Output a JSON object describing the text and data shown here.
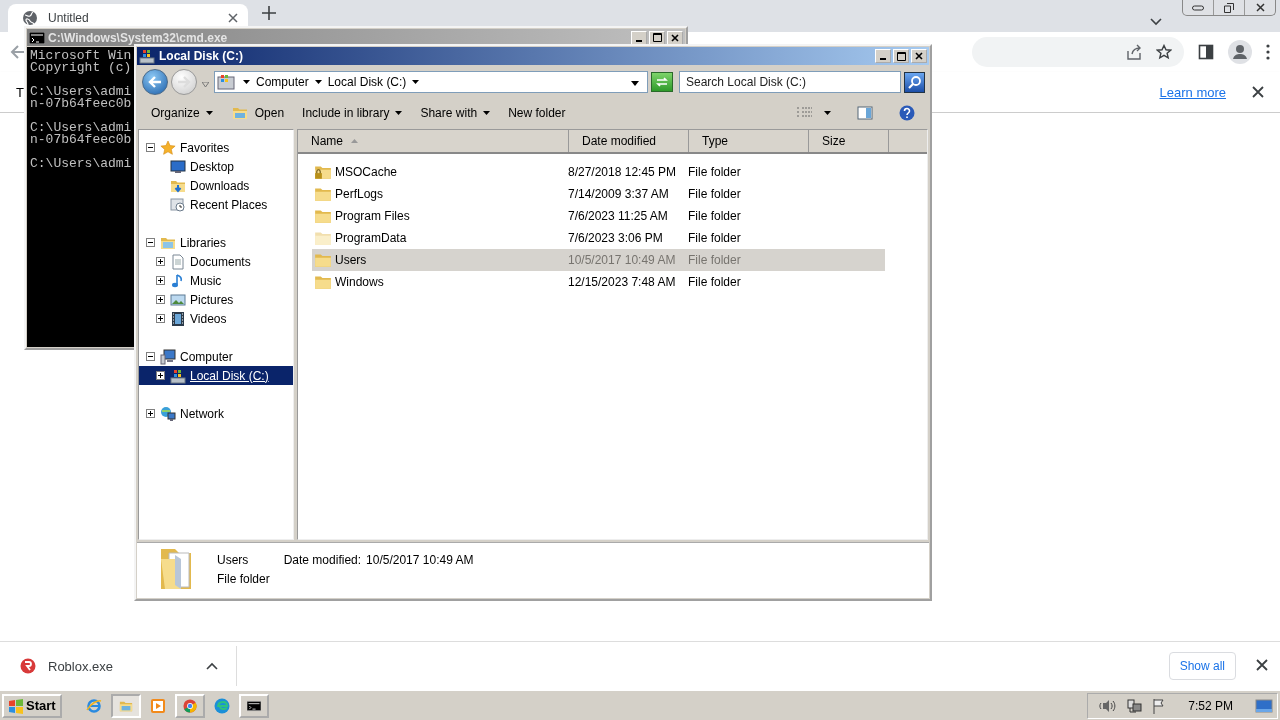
{
  "browser": {
    "tabs": [
      {
        "title": "Untitled",
        "selected": true
      }
    ],
    "infobar": {
      "text": "T",
      "link": "Learn more"
    },
    "download_shelf": {
      "items": [
        {
          "name": "Roblox.exe"
        }
      ],
      "show_all": "Show all"
    }
  },
  "cmd_window": {
    "title": "C:\\Windows\\System32\\cmd.exe",
    "active": false,
    "blocks": [
      [
        "Microsoft Win",
        "Copyright (c)"
      ],
      [
        "C:\\Users\\admi",
        "n-07b64feec0b"
      ],
      [
        "C:\\Users\\admi",
        "n-07b64feec0b"
      ],
      [
        "C:\\Users\\admi"
      ]
    ]
  },
  "explorer": {
    "title": "Local Disk (C:)",
    "active": true,
    "breadcrumb": [
      "Computer",
      "Local Disk (C:)"
    ],
    "search": {
      "placeholder": "Search Local Disk (C:)"
    },
    "toolbar": [
      {
        "label": "Organize",
        "dropdown": true,
        "icon": false
      },
      {
        "label": "Open",
        "dropdown": false,
        "icon": true
      },
      {
        "label": "Include in library",
        "dropdown": true,
        "icon": false
      },
      {
        "label": "Share with",
        "dropdown": true,
        "icon": false
      },
      {
        "label": "New folder",
        "dropdown": false,
        "icon": false
      }
    ],
    "nav": [
      {
        "label": "Favorites",
        "kind": "star",
        "expanded": true,
        "selected": false,
        "children": [
          {
            "label": "Desktop",
            "kind": "desktop",
            "selected": false
          },
          {
            "label": "Downloads",
            "kind": "download",
            "selected": false
          },
          {
            "label": "Recent Places",
            "kind": "recent",
            "selected": false
          }
        ]
      },
      {
        "label": "Libraries",
        "kind": "library",
        "expanded": true,
        "selected": false,
        "children": [
          {
            "label": "Documents",
            "kind": "document",
            "expanded": false,
            "selected": false
          },
          {
            "label": "Music",
            "kind": "music",
            "expanded": false,
            "selected": false
          },
          {
            "label": "Pictures",
            "kind": "pictures",
            "expanded": false,
            "selected": false
          },
          {
            "label": "Videos",
            "kind": "video",
            "expanded": false,
            "selected": false
          }
        ]
      },
      {
        "label": "Computer",
        "kind": "computer",
        "expanded": true,
        "selected": false,
        "children": [
          {
            "label": "Local Disk (C:)",
            "kind": "disk",
            "expanded": false,
            "selected": true
          }
        ]
      },
      {
        "label": "Network",
        "kind": "network",
        "expanded": false,
        "selected": false
      }
    ],
    "columns": [
      {
        "label": "Name",
        "sorted": true
      },
      {
        "label": "Date modified",
        "sorted": false
      },
      {
        "label": "Type",
        "sorted": false
      },
      {
        "label": "Size",
        "sorted": false
      }
    ],
    "rows": [
      {
        "name": "MSOCache",
        "date": "8/27/2018 12:45 PM",
        "type": "File folder",
        "kind": "locked",
        "selected": false
      },
      {
        "name": "PerfLogs",
        "date": "7/14/2009 3:37 AM",
        "type": "File folder",
        "kind": "folder",
        "selected": false
      },
      {
        "name": "Program Files",
        "date": "7/6/2023 11:25 AM",
        "type": "File folder",
        "kind": "folder",
        "selected": false
      },
      {
        "name": "ProgramData",
        "date": "7/6/2023 3:06 PM",
        "type": "File folder",
        "kind": "hidden",
        "selected": false
      },
      {
        "name": "Users",
        "date": "10/5/2017 10:49 AM",
        "type": "File folder",
        "kind": "folder",
        "selected": true
      },
      {
        "name": "Windows",
        "date": "12/15/2023 7:48 AM",
        "type": "File folder",
        "kind": "folder",
        "selected": false
      }
    ],
    "details": {
      "name": "Users",
      "date_label": "Date modified:",
      "date": "10/5/2017 10:49 AM",
      "type": "File folder"
    }
  },
  "taskbar": {
    "start": "Start",
    "apps": [
      {
        "kind": "ie",
        "running": false,
        "active": false
      },
      {
        "kind": "explorer",
        "running": true,
        "active": true
      },
      {
        "kind": "media",
        "running": false,
        "active": false
      },
      {
        "kind": "chrome",
        "running": true,
        "active": false
      },
      {
        "kind": "edge",
        "running": false,
        "active": false
      },
      {
        "kind": "cmd",
        "running": true,
        "active": false
      }
    ],
    "time": "7:52 PM"
  }
}
